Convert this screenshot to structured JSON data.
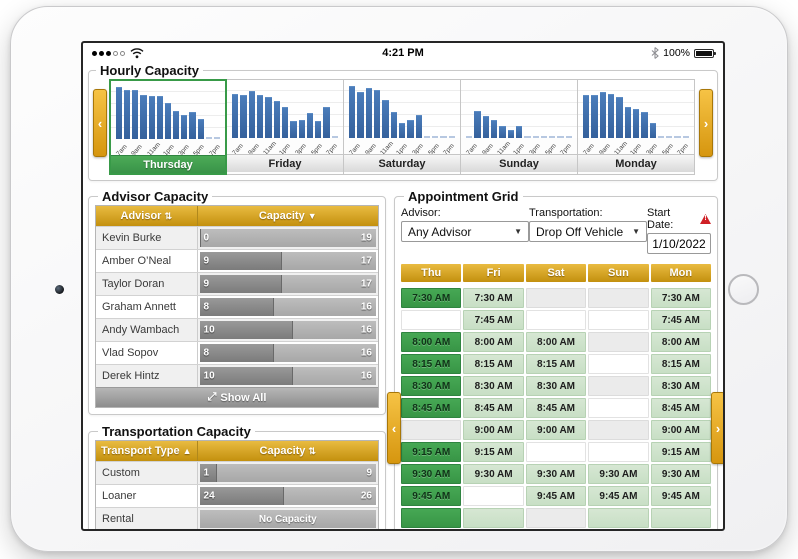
{
  "colors": {
    "gold": "#d9a21a",
    "selected_green": "#3fa24d",
    "light_green": "#cfe3cc",
    "bar_blue": "#3d6fae",
    "warning_red": "#cf2026",
    "track_gray": "#b0b0b0"
  },
  "icons": {
    "chevron_left": "‹",
    "chevron_right": "›",
    "expand": "⤢",
    "warning_mark": "!",
    "select_caret": "▼",
    "sort_both": "⇅",
    "sort_desc": "▼",
    "sort_asc": "▲"
  },
  "status_bar": {
    "time": "4:21 PM",
    "battery_pct": "100%",
    "signal_filled": 3,
    "signal_total": 5
  },
  "hourly": {
    "title": "Hourly Capacity",
    "type": "bar",
    "x_labels": [
      "7am",
      "9am",
      "11am",
      "1pm",
      "3pm",
      "5pm",
      "7pm"
    ],
    "ylim": [
      0,
      10
    ],
    "days": [
      {
        "label": "Thursday",
        "selected": true,
        "values": [
          10,
          9.4,
          9.5,
          8.4,
          8.2,
          8.3,
          6.9,
          5.3,
          4.6,
          5.1,
          3.9,
          0,
          0
        ]
      },
      {
        "label": "Friday",
        "selected": false,
        "values": [
          8.5,
          8.3,
          9.0,
          8.2,
          7.8,
          7.2,
          6.0,
          3.2,
          3.4,
          4.8,
          3.2,
          6.0,
          0
        ]
      },
      {
        "label": "Saturday",
        "selected": false,
        "values": [
          10,
          8.8,
          9.6,
          9.2,
          7.3,
          5.0,
          2.9,
          3.5,
          4.5,
          0,
          0,
          0,
          0
        ]
      },
      {
        "label": "Sunday",
        "selected": false,
        "values": [
          0,
          5.2,
          4.3,
          3.4,
          2.4,
          1.6,
          2.4,
          0,
          0,
          0,
          0,
          0,
          0
        ]
      },
      {
        "label": "Monday",
        "selected": false,
        "values": [
          8.3,
          8.3,
          8.9,
          8.4,
          7.8,
          5.9,
          5.6,
          5.0,
          2.8,
          0,
          0,
          0,
          0
        ]
      }
    ]
  },
  "advisor": {
    "title": "Advisor Capacity",
    "col_name": "Advisor",
    "col_capacity": "Capacity",
    "name_sort": "⇅",
    "cap_sort": "▼",
    "show_all_label": "Show All",
    "rows": [
      {
        "name": "Kevin Burke",
        "used": "0",
        "total": "19",
        "pct": 0
      },
      {
        "name": "Amber O’Neal",
        "used": "9",
        "total": "17",
        "pct": 47
      },
      {
        "name": "Taylor Doran",
        "used": "9",
        "total": "17",
        "pct": 47
      },
      {
        "name": "Graham Annett",
        "used": "8",
        "total": "16",
        "pct": 42
      },
      {
        "name": "Andy Wambach",
        "used": "10",
        "total": "16",
        "pct": 53
      },
      {
        "name": "Vlad Sopov",
        "used": "8",
        "total": "16",
        "pct": 42
      },
      {
        "name": "Derek Hintz",
        "used": "10",
        "total": "16",
        "pct": 53
      }
    ]
  },
  "transport": {
    "title": "Transportation Capacity",
    "col_name": "Transport Type",
    "col_capacity": "Capacity",
    "name_sort": "▲",
    "cap_sort": "⇅",
    "rows": [
      {
        "name": "Custom",
        "used": "1",
        "total": "9",
        "pct": 10
      },
      {
        "name": "Loaner",
        "used": "24",
        "total": "26",
        "pct": 48
      },
      {
        "name": "Rental",
        "no_capacity": "No Capacity"
      }
    ]
  },
  "appointments": {
    "title": "Appointment Grid",
    "advisor_label": "Advisor:",
    "advisor_value": "Any Advisor",
    "transport_label": "Transportation:",
    "transport_value": "Drop Off Vehicle",
    "date_label": "Start Date:",
    "date_value": "1/10/2022",
    "days": [
      "Thu",
      "Fri",
      "Sat",
      "Sun",
      "Mon"
    ],
    "rows": [
      {
        "time": "7:30 AM",
        "cells": [
          "sel",
          "avail",
          "gray",
          "gray",
          "avail"
        ]
      },
      {
        "time": "7:45 AM",
        "cells": [
          "white",
          "avail",
          "white",
          "white",
          "avail"
        ]
      },
      {
        "time": "8:00 AM",
        "cells": [
          "sel",
          "avail",
          "avail",
          "gray",
          "avail"
        ]
      },
      {
        "time": "8:15 AM",
        "cells": [
          "sel",
          "avail",
          "avail",
          "white",
          "avail"
        ]
      },
      {
        "time": "8:30 AM",
        "cells": [
          "sel",
          "avail",
          "avail",
          "gray",
          "avail"
        ]
      },
      {
        "time": "8:45 AM",
        "cells": [
          "sel",
          "avail",
          "avail",
          "white",
          "avail"
        ]
      },
      {
        "time": "9:00 AM",
        "cells": [
          "gray",
          "avail",
          "avail",
          "gray",
          "avail"
        ]
      },
      {
        "time": "9:15 AM",
        "cells": [
          "sel",
          "avail",
          "white",
          "white",
          "avail"
        ]
      },
      {
        "time": "9:30 AM",
        "cells": [
          "sel",
          "avail",
          "avail",
          "avail",
          "avail"
        ]
      },
      {
        "time": "9:45 AM",
        "cells": [
          "sel",
          "white",
          "avail",
          "avail",
          "avail"
        ]
      },
      {
        "time": "",
        "cells": [
          "sel",
          "avail",
          "gray",
          "avail",
          "avail"
        ]
      }
    ]
  }
}
